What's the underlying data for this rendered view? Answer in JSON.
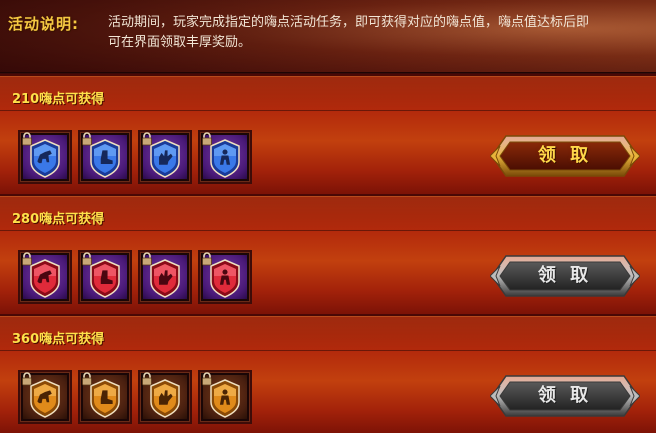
{
  "description": {
    "label": "活动说明:",
    "line1": "活动期间，玩家完成指定的嗨点活动任务，即可获得对应的嗨点值，嗨点值达标后即",
    "line2": "可在界面领取丰厚奖励。"
  },
  "rewards": [
    {
      "title": "210嗨点可获得",
      "button": "领 取",
      "button_state": "active",
      "theme": "blue",
      "items": [
        {
          "icon": "blue-horse-shield-icon",
          "locked": true
        },
        {
          "icon": "blue-boot-shield-icon",
          "locked": true
        },
        {
          "icon": "blue-glove-shield-icon",
          "locked": true
        },
        {
          "icon": "blue-figure-shield-icon",
          "locked": true
        }
      ]
    },
    {
      "title": "280嗨点可获得",
      "button": "领 取",
      "button_state": "inactive",
      "theme": "red",
      "items": [
        {
          "icon": "red-horse-shield-icon",
          "locked": true
        },
        {
          "icon": "red-boot-shield-icon",
          "locked": true
        },
        {
          "icon": "red-glove-shield-icon",
          "locked": true
        },
        {
          "icon": "red-figure-shield-icon",
          "locked": true
        }
      ]
    },
    {
      "title": "360嗨点可获得",
      "button": "领 取",
      "button_state": "inactive",
      "theme": "orange",
      "items": [
        {
          "icon": "orange-horse-shield-icon",
          "locked": true
        },
        {
          "icon": "orange-boot-shield-icon",
          "locked": true
        },
        {
          "icon": "orange-glove-shield-icon",
          "locked": true
        },
        {
          "icon": "orange-figure-shield-icon",
          "locked": true
        }
      ]
    }
  ],
  "colors": {
    "blue": "#3a6ad8",
    "red": "#d8283a",
    "orange": "#d87a1a",
    "title_yellow": "#ffe14a",
    "label_gold": "#f5c842"
  }
}
